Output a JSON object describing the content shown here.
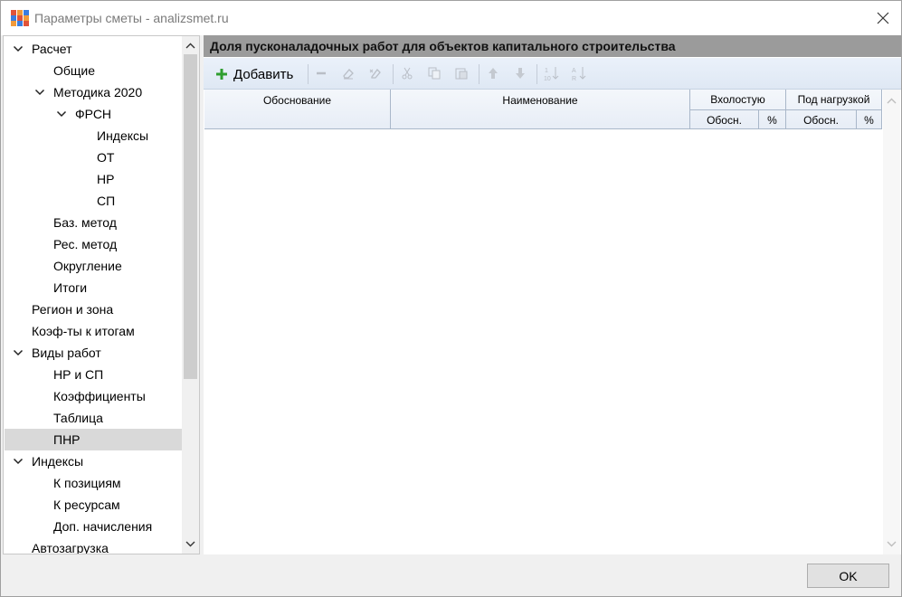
{
  "window": {
    "title": "Параметры сметы - analizsmet.ru"
  },
  "tree": {
    "items": [
      {
        "label": "Расчет",
        "level": 0,
        "expanded": true
      },
      {
        "label": "Общие",
        "level": 1
      },
      {
        "label": "Методика 2020",
        "level": 1,
        "expanded": true
      },
      {
        "label": "ФРСН",
        "level": 2,
        "expanded": true
      },
      {
        "label": "Индексы",
        "level": 3
      },
      {
        "label": "ОТ",
        "level": 3
      },
      {
        "label": "НР",
        "level": 3
      },
      {
        "label": "СП",
        "level": 3
      },
      {
        "label": "Баз. метод",
        "level": 1
      },
      {
        "label": "Рес. метод",
        "level": 1
      },
      {
        "label": "Округление",
        "level": 1
      },
      {
        "label": "Итоги",
        "level": 1
      },
      {
        "label": "Регион и зона",
        "level": 0
      },
      {
        "label": "Коэф-ты к итогам",
        "level": 0
      },
      {
        "label": "Виды работ",
        "level": 0,
        "expanded": true
      },
      {
        "label": "НР и СП",
        "level": 1
      },
      {
        "label": "Коэффициенты",
        "level": 1
      },
      {
        "label": "Таблица",
        "level": 1
      },
      {
        "label": "ПНР",
        "level": 1,
        "selected": true
      },
      {
        "label": "Индексы",
        "level": 0,
        "expanded": true
      },
      {
        "label": "К позициям",
        "level": 1
      },
      {
        "label": "К ресурсам",
        "level": 1
      },
      {
        "label": "Доп. начисления",
        "level": 1
      },
      {
        "label": "Автозагрузка",
        "level": 0
      }
    ]
  },
  "panel": {
    "title": "Доля пусконаладочных работ для объектов капитального строительства"
  },
  "toolbar": {
    "add_label": "Добавить",
    "icons": [
      "remove-icon",
      "eraser-icon",
      "clear-icon",
      "cut-icon",
      "copy-icon",
      "paste-icon",
      "move-up-icon",
      "move-down-icon",
      "sort-numeric-icon",
      "sort-alpha-icon"
    ]
  },
  "grid": {
    "col_basis": "Обоснование",
    "col_name": "Наименование",
    "group_idle": "Вхолостую",
    "group_load": "Под нагрузкой",
    "sub_basis_idle": "Обосн.",
    "sub_pct_idle": "%",
    "sub_basis_load": "Обосн.",
    "sub_pct_load": "%",
    "rows": []
  },
  "footer": {
    "ok_label": "OK"
  }
}
